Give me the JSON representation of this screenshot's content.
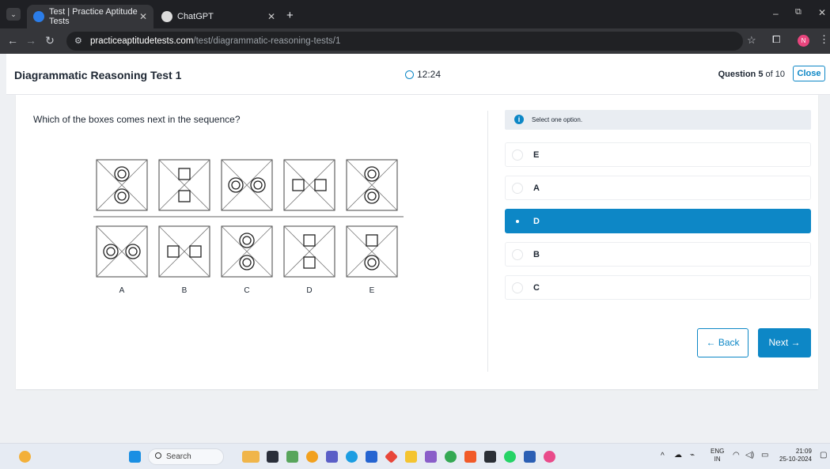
{
  "browser": {
    "tabs": [
      {
        "title": "Test | Practice Aptitude Tests",
        "active": true
      },
      {
        "title": "ChatGPT",
        "active": false
      }
    ],
    "new_tab": "+",
    "url_host": "practiceaptitudetests.com",
    "url_path": "/test/diagrammatic-reasoning-tests/1",
    "profile_initial": "N"
  },
  "header": {
    "title": "Diagrammatic Reasoning Test 1",
    "timer": "12:24",
    "question_label": "Question",
    "question_number": "5",
    "question_of": "of 10",
    "close_label": "Close"
  },
  "question": {
    "text": "Which of the boxes comes next in the sequence?",
    "sequence": [
      {
        "shapes": [
          "circle",
          "circle"
        ],
        "arrangement": "vertical"
      },
      {
        "shapes": [
          "square",
          "square"
        ],
        "arrangement": "vertical"
      },
      {
        "shapes": [
          "circle",
          "circle"
        ],
        "arrangement": "horizontal"
      },
      {
        "shapes": [
          "square",
          "square"
        ],
        "arrangement": "horizontal"
      },
      {
        "shapes": [
          "circle",
          "circle"
        ],
        "arrangement": "vertical"
      }
    ],
    "answers": [
      {
        "label": "A",
        "shapes": [
          "circle",
          "circle"
        ],
        "arrangement": "horizontal"
      },
      {
        "label": "B",
        "shapes": [
          "square",
          "square"
        ],
        "arrangement": "horizontal"
      },
      {
        "label": "C",
        "shapes": [
          "circle",
          "circle"
        ],
        "arrangement": "vertical"
      },
      {
        "label": "D",
        "shapes": [
          "square",
          "square"
        ],
        "arrangement": "vertical"
      },
      {
        "label": "E",
        "shapes": [
          "square",
          "circle"
        ],
        "arrangement": "vertical"
      }
    ]
  },
  "options": {
    "instruction": "Select one option.",
    "items": [
      {
        "label": "E",
        "selected": false
      },
      {
        "label": "A",
        "selected": false
      },
      {
        "label": "D",
        "selected": true
      },
      {
        "label": "B",
        "selected": false
      },
      {
        "label": "C",
        "selected": false
      }
    ],
    "back_label": "← Back",
    "next_label": "Next →"
  },
  "taskbar": {
    "search_placeholder": "Search",
    "lang": "ENG",
    "region": "IN",
    "time": "21:09",
    "date": "25-10-2024"
  },
  "colors": {
    "accent": "#0d87c6",
    "text": "#1e2733"
  }
}
